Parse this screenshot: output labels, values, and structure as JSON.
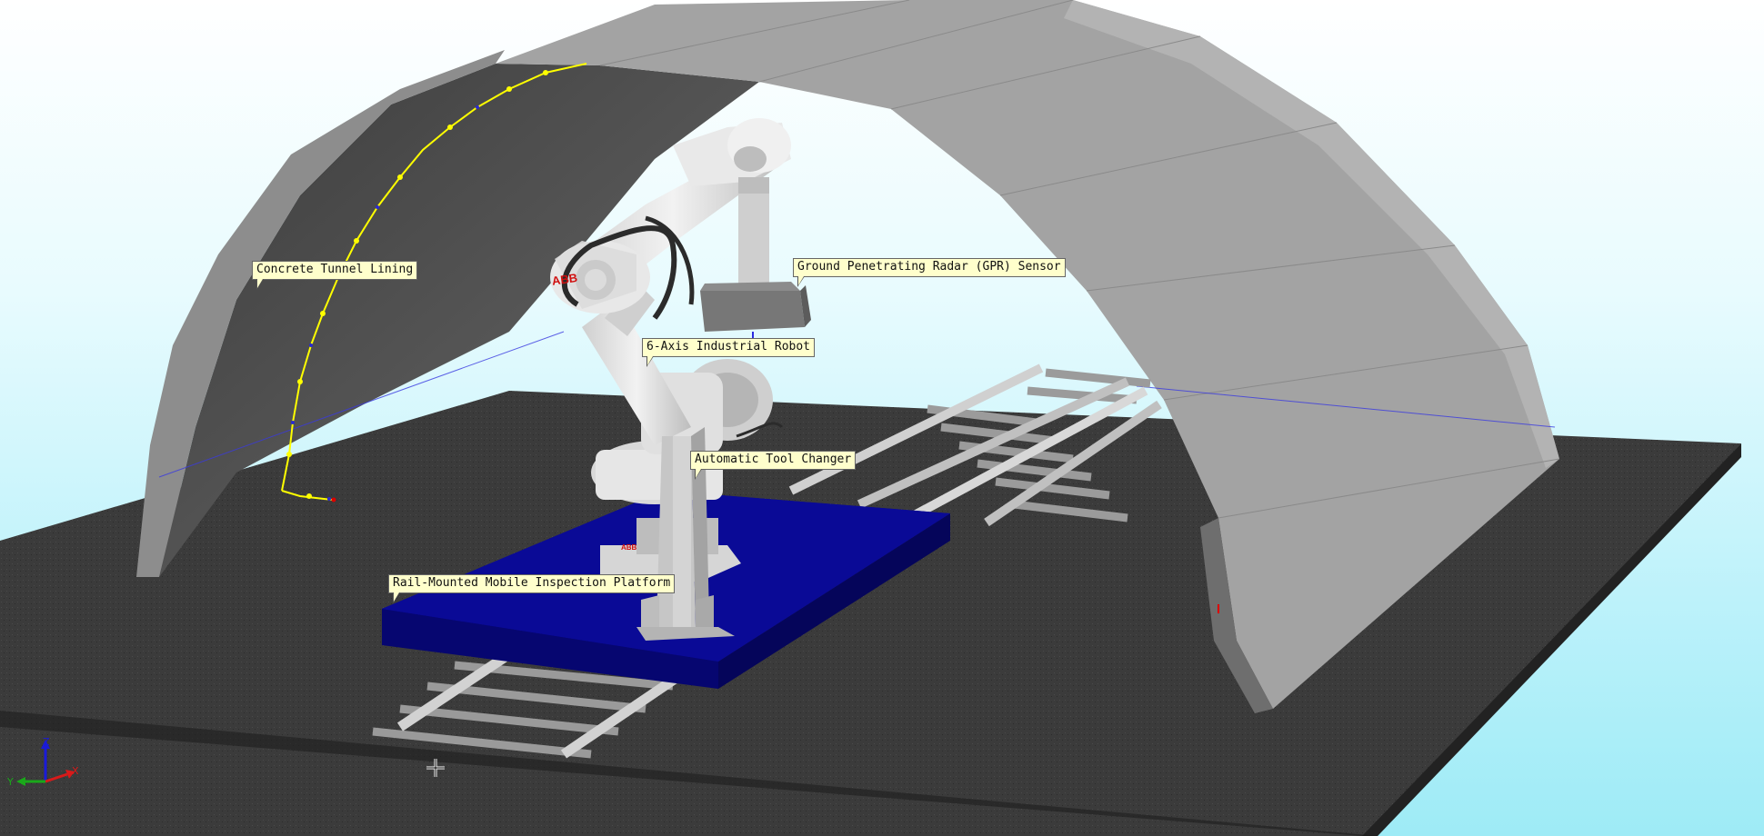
{
  "labels": {
    "tunnel": "Concrete Tunnel Lining",
    "gpr": "Ground Penetrating Radar (GPR) Sensor",
    "robot": "6-Axis Industrial Robot",
    "changer": "Automatic Tool Changer",
    "platform": "Rail-Mounted Mobile Inspection Platform"
  },
  "robot_logo": "ABB",
  "axes": {
    "x": "X",
    "y": "Y",
    "z": "Z"
  },
  "colors": {
    "floor": "#3a3a3a",
    "tunnel_outer": "#a8a8a8",
    "tunnel_inner": "#4a4a4a",
    "platform": "#0b0b8c",
    "path": "#ffff00",
    "callout_bg": "#ffffcc"
  }
}
